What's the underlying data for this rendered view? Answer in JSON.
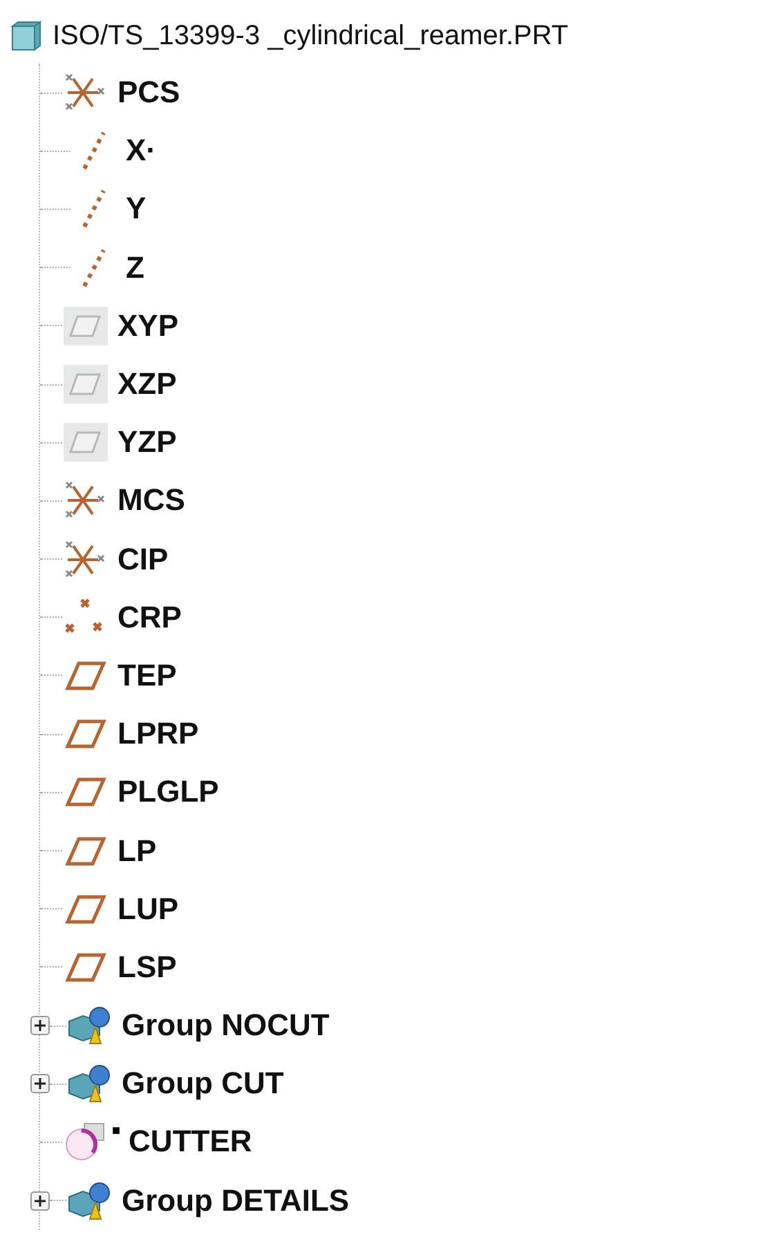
{
  "root": {
    "label": "ISO/TS_13399-3 _cylindrical_reamer.PRT"
  },
  "children": [
    {
      "kind": "csys",
      "label": "PCS"
    },
    {
      "kind": "axis",
      "label": "X·"
    },
    {
      "kind": "axis",
      "label": "Y"
    },
    {
      "kind": "axis",
      "label": "Z"
    },
    {
      "kind": "plane_faded",
      "label": "XYP"
    },
    {
      "kind": "plane_faded",
      "label": "XZP"
    },
    {
      "kind": "plane_faded",
      "label": "YZP"
    },
    {
      "kind": "csys",
      "label": "MCS"
    },
    {
      "kind": "csys",
      "label": "CIP"
    },
    {
      "kind": "points",
      "label": "CRP"
    },
    {
      "kind": "plane",
      "label": "TEP"
    },
    {
      "kind": "plane",
      "label": "LPRP"
    },
    {
      "kind": "plane",
      "label": "PLGLP"
    },
    {
      "kind": "plane",
      "label": "LP"
    },
    {
      "kind": "plane",
      "label": "LUP"
    },
    {
      "kind": "plane",
      "label": "LSP"
    },
    {
      "kind": "group",
      "label": "Group NOCUT",
      "expanded": false
    },
    {
      "kind": "group",
      "label": "Group CUT",
      "expanded": false
    },
    {
      "kind": "cutter",
      "label": "CUTTER",
      "marker": "■"
    },
    {
      "kind": "group",
      "label": "Group DETAILS",
      "expanded": false
    }
  ]
}
